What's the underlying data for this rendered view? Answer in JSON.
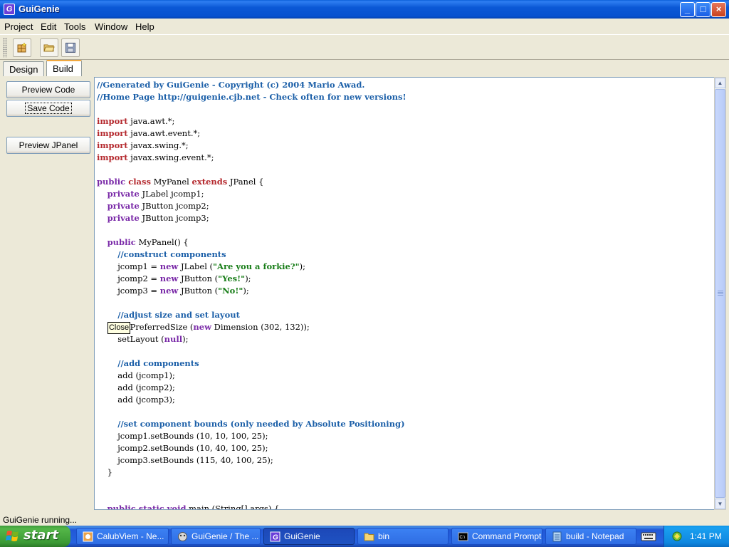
{
  "window": {
    "title": "GuiGenie",
    "icon_letter": "G",
    "controls": {
      "minimize": "_",
      "maximize": "□",
      "close": "×"
    }
  },
  "menu": [
    "Project",
    "Edit",
    "Tools",
    "Window",
    "Help"
  ],
  "toolbar": {
    "buttons": [
      "new-component-icon",
      "open-folder-icon",
      "save-disk-icon"
    ]
  },
  "tabs": [
    {
      "label": "Design",
      "active": false
    },
    {
      "label": "Build",
      "active": true
    }
  ],
  "sidebar": {
    "preview_code": "Preview Code",
    "save_code": "Save Code",
    "preview_jpanel": "Preview JPanel"
  },
  "code_lines": [
    [
      [
        "comment",
        "//Generated by GuiGenie - Copyright (c) 2004 Mario Awad."
      ]
    ],
    [
      [
        "comment",
        "//Home Page http://guigenie.cjb.net - Check often for new versions!"
      ]
    ],
    [],
    [
      [
        "red",
        "import"
      ],
      [
        "plain",
        " java.awt.*;"
      ]
    ],
    [
      [
        "red",
        "import"
      ],
      [
        "plain",
        " java.awt.event.*;"
      ]
    ],
    [
      [
        "red",
        "import"
      ],
      [
        "plain",
        " javax.swing.*;"
      ]
    ],
    [
      [
        "red",
        "import"
      ],
      [
        "plain",
        " javax.swing.event.*;"
      ]
    ],
    [],
    [
      [
        "purple",
        "public"
      ],
      [
        "red",
        " class"
      ],
      [
        "plain",
        " MyPanel "
      ],
      [
        "red",
        "extends"
      ],
      [
        "plain",
        " JPanel {"
      ]
    ],
    [
      [
        "plain",
        "    "
      ],
      [
        "purple",
        "private"
      ],
      [
        "plain",
        " JLabel jcomp1;"
      ]
    ],
    [
      [
        "plain",
        "    "
      ],
      [
        "purple",
        "private"
      ],
      [
        "plain",
        " JButton jcomp2;"
      ]
    ],
    [
      [
        "plain",
        "    "
      ],
      [
        "purple",
        "private"
      ],
      [
        "plain",
        " JButton jcomp3;"
      ]
    ],
    [],
    [
      [
        "plain",
        "    "
      ],
      [
        "purple",
        "public"
      ],
      [
        "plain",
        " MyPanel() {"
      ]
    ],
    [
      [
        "plain",
        "        "
      ],
      [
        "comment",
        "//construct components"
      ]
    ],
    [
      [
        "plain",
        "        jcomp1 = "
      ],
      [
        "purple",
        "new"
      ],
      [
        "plain",
        " JLabel ("
      ],
      [
        "str",
        "\"Are you a forkie?\""
      ],
      [
        "plain",
        ");"
      ]
    ],
    [
      [
        "plain",
        "        jcomp2 = "
      ],
      [
        "purple",
        "new"
      ],
      [
        "plain",
        " JButton ("
      ],
      [
        "str",
        "\"Yes!\""
      ],
      [
        "plain",
        ");"
      ]
    ],
    [
      [
        "plain",
        "        jcomp3 = "
      ],
      [
        "purple",
        "new"
      ],
      [
        "plain",
        " JButton ("
      ],
      [
        "str",
        "\"No!\""
      ],
      [
        "plain",
        ");"
      ]
    ],
    [],
    [
      [
        "plain",
        "        "
      ],
      [
        "comment",
        "//adjust size and set layout"
      ]
    ],
    [
      [
        "plain",
        "        setPreferredSize ("
      ],
      [
        "purple",
        "new"
      ],
      [
        "plain",
        " Dimension (302, 132));"
      ]
    ],
    [
      [
        "plain",
        "        setLayout ("
      ],
      [
        "purple",
        "null"
      ],
      [
        "plain",
        ");"
      ]
    ],
    [],
    [
      [
        "plain",
        "        "
      ],
      [
        "comment",
        "//add components"
      ]
    ],
    [
      [
        "plain",
        "        add (jcomp1);"
      ]
    ],
    [
      [
        "plain",
        "        add (jcomp2);"
      ]
    ],
    [
      [
        "plain",
        "        add (jcomp3);"
      ]
    ],
    [],
    [
      [
        "plain",
        "        "
      ],
      [
        "comment",
        "//set component bounds (only needed by Absolute Positioning)"
      ]
    ],
    [
      [
        "plain",
        "        jcomp1.setBounds (10, 10, 100, 25);"
      ]
    ],
    [
      [
        "plain",
        "        jcomp2.setBounds (10, 40, 100, 25);"
      ]
    ],
    [
      [
        "plain",
        "        jcomp3.setBounds (115, 40, 100, 25);"
      ]
    ],
    [
      [
        "plain",
        "    }"
      ]
    ],
    [],
    [],
    [
      [
        "plain",
        "    "
      ],
      [
        "purple",
        "public static void"
      ],
      [
        "plain",
        " main (String[] args) {"
      ]
    ]
  ],
  "tooltip": "Close",
  "status": "GuiGenie running...",
  "taskbar": {
    "start_label": "start",
    "tasks": [
      {
        "label": "CalubViem - Ne...",
        "icon": "browser-icon"
      },
      {
        "label": "GuiGenie / The ...",
        "icon": "guigenie-web-icon"
      },
      {
        "label": "GuiGenie",
        "icon": "guigenie-icon",
        "active": true
      },
      {
        "label": "bin",
        "icon": "folder-icon"
      },
      {
        "label": "Command Prompt",
        "icon": "cmd-icon"
      },
      {
        "label": "build - Notepad",
        "icon": "notepad-icon"
      }
    ],
    "clock": "1:41 PM"
  },
  "colors": {
    "comment": "#1b5fa8",
    "keyword_red": "#b4282d",
    "keyword_purple": "#7a2aa8",
    "string": "#187d18"
  }
}
